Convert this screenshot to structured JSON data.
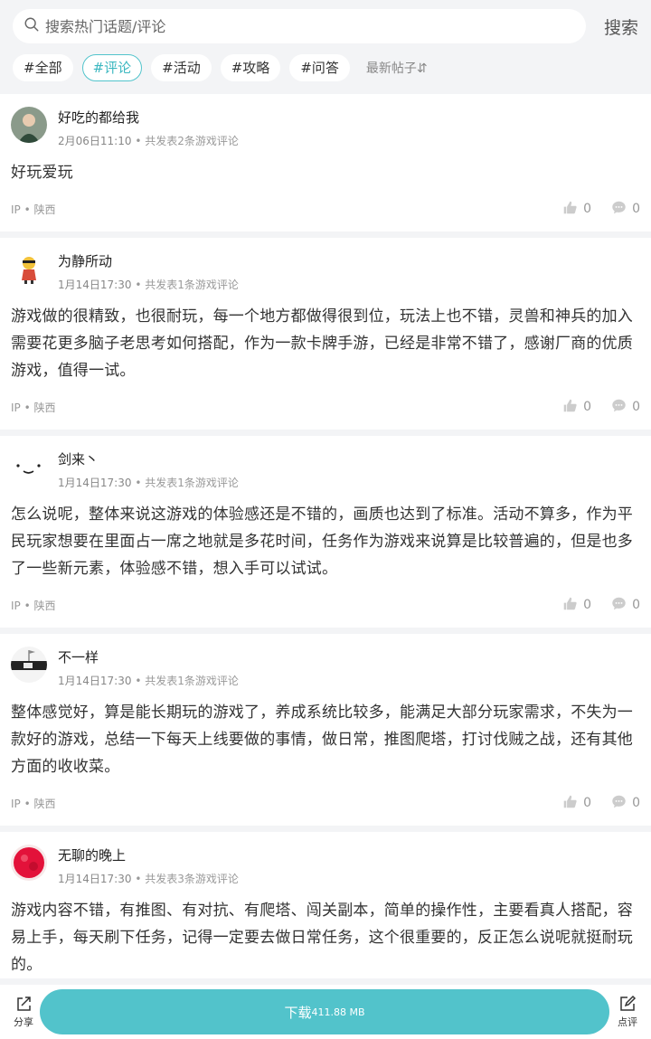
{
  "search": {
    "placeholder": "搜索热门话题/评论",
    "button": "搜索"
  },
  "tags": [
    "#全部",
    "#评论",
    "#活动",
    "#攻略",
    "#问答"
  ],
  "active_tag_index": 1,
  "sort_label": "最新帖子⇵",
  "posts": [
    {
      "username": "好吃的都给我",
      "date": "2月06日11:10",
      "stats": "• 共发表2条游戏评论",
      "content": "好玩爱玩",
      "ip": "IP • 陕西",
      "likes": "0",
      "comments": "0"
    },
    {
      "username": "为静所动",
      "date": "1月14日17:30",
      "stats": "• 共发表1条游戏评论",
      "content": "游戏做的很精致，也很耐玩，每一个地方都做得很到位，玩法上也不错，灵兽和神兵的加入需要花更多脑子老思考如何搭配，作为一款卡牌手游，已经是非常不错了，感谢厂商的优质游戏，值得一试。",
      "ip": "IP • 陕西",
      "likes": "0",
      "comments": "0"
    },
    {
      "username": "剑来丶",
      "date": "1月14日17:30",
      "stats": "• 共发表1条游戏评论",
      "content": "怎么说呢，整体来说这游戏的体验感还是不错的，画质也达到了标准。活动不算多，作为平民玩家想要在里面占一席之地就是多花时间，任务作为游戏来说算是比较普遍的，但是也多了一些新元素，体验感不错，想入手可以试试。",
      "ip": "IP • 陕西",
      "likes": "0",
      "comments": "0"
    },
    {
      "username": "不一样",
      "date": "1月14日17:30",
      "stats": "• 共发表1条游戏评论",
      "content": "整体感觉好，算是能长期玩的游戏了，养成系统比较多，能满足大部分玩家需求，不失为一款好的游戏，总结一下每天上线要做的事情，做日常，推图爬塔，打讨伐贼之战，还有其他方面的收收菜。",
      "ip": "IP • 陕西",
      "likes": "0",
      "comments": "0"
    },
    {
      "username": "无聊的晚上",
      "date": "1月14日17:30",
      "stats": "• 共发表3条游戏评论",
      "content": "游戏内容不错，有推图、有对抗、有爬塔、闯关副本，简单的操作性，主要看真人搭配，容易上手，每天刷下任务，记得一定要去做日常任务，这个很重要的，反正怎么说呢就挺耐玩的。",
      "ip": "",
      "likes": "",
      "comments": ""
    }
  ],
  "bottom": {
    "share": "分享",
    "download": "下载",
    "size": "411.88 MB",
    "review": "点评"
  },
  "colors": {
    "accent": "#52c3cb"
  }
}
